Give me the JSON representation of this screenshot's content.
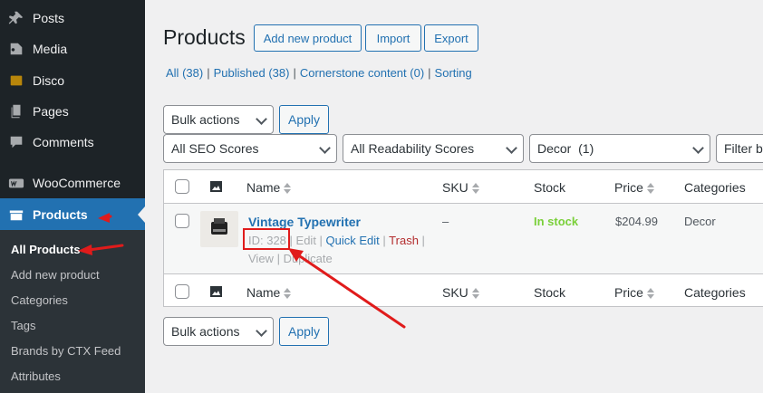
{
  "sidebar": {
    "items": [
      {
        "label": "Posts",
        "icon": "pushpin-icon"
      },
      {
        "label": "Media",
        "icon": "media-icon"
      },
      {
        "label": "Disco",
        "icon": "disco-icon"
      },
      {
        "label": "Pages",
        "icon": "pages-icon"
      },
      {
        "label": "Comments",
        "icon": "comment-icon"
      },
      {
        "label": "WooCommerce",
        "icon": "woocommerce-icon"
      },
      {
        "label": "Products",
        "icon": "products-icon"
      }
    ],
    "submenu": [
      "All Products",
      "Add new product",
      "Categories",
      "Tags",
      "Brands by CTX Feed",
      "Attributes"
    ]
  },
  "page": {
    "title": "Products",
    "buttons": {
      "add": "Add new product",
      "import": "Import",
      "export": "Export"
    },
    "views": {
      "all": "All",
      "all_count": "(38)",
      "published": "Published",
      "published_count": "(38)",
      "cornerstone": "Cornerstone content",
      "cornerstone_count": "(0)",
      "sorting": "Sorting",
      "sep": "|"
    }
  },
  "filters": {
    "bulk_actions": "Bulk actions",
    "apply": "Apply",
    "seo": "All SEO Scores",
    "readability": "All Readability Scores",
    "category": "Decor  (1)",
    "filter_by": "Filter by"
  },
  "table": {
    "columns": {
      "name": "Name",
      "sku": "SKU",
      "stock": "Stock",
      "price": "Price",
      "categories": "Categories"
    },
    "rows": [
      {
        "name": "Vintage Typewriter",
        "id": "ID: 328",
        "edit": "Edit",
        "quick_edit": "Quick Edit",
        "trash": "Trash",
        "view": "View",
        "duplicate": "Duplicate",
        "sku": "–",
        "stock": "In stock",
        "price": "$204.99",
        "category": "Decor"
      }
    ]
  },
  "colors": {
    "accent": "#2271b1",
    "sidebar": "#1d2327",
    "annotation": "#e01b1b",
    "in_stock": "#7ad03a"
  }
}
